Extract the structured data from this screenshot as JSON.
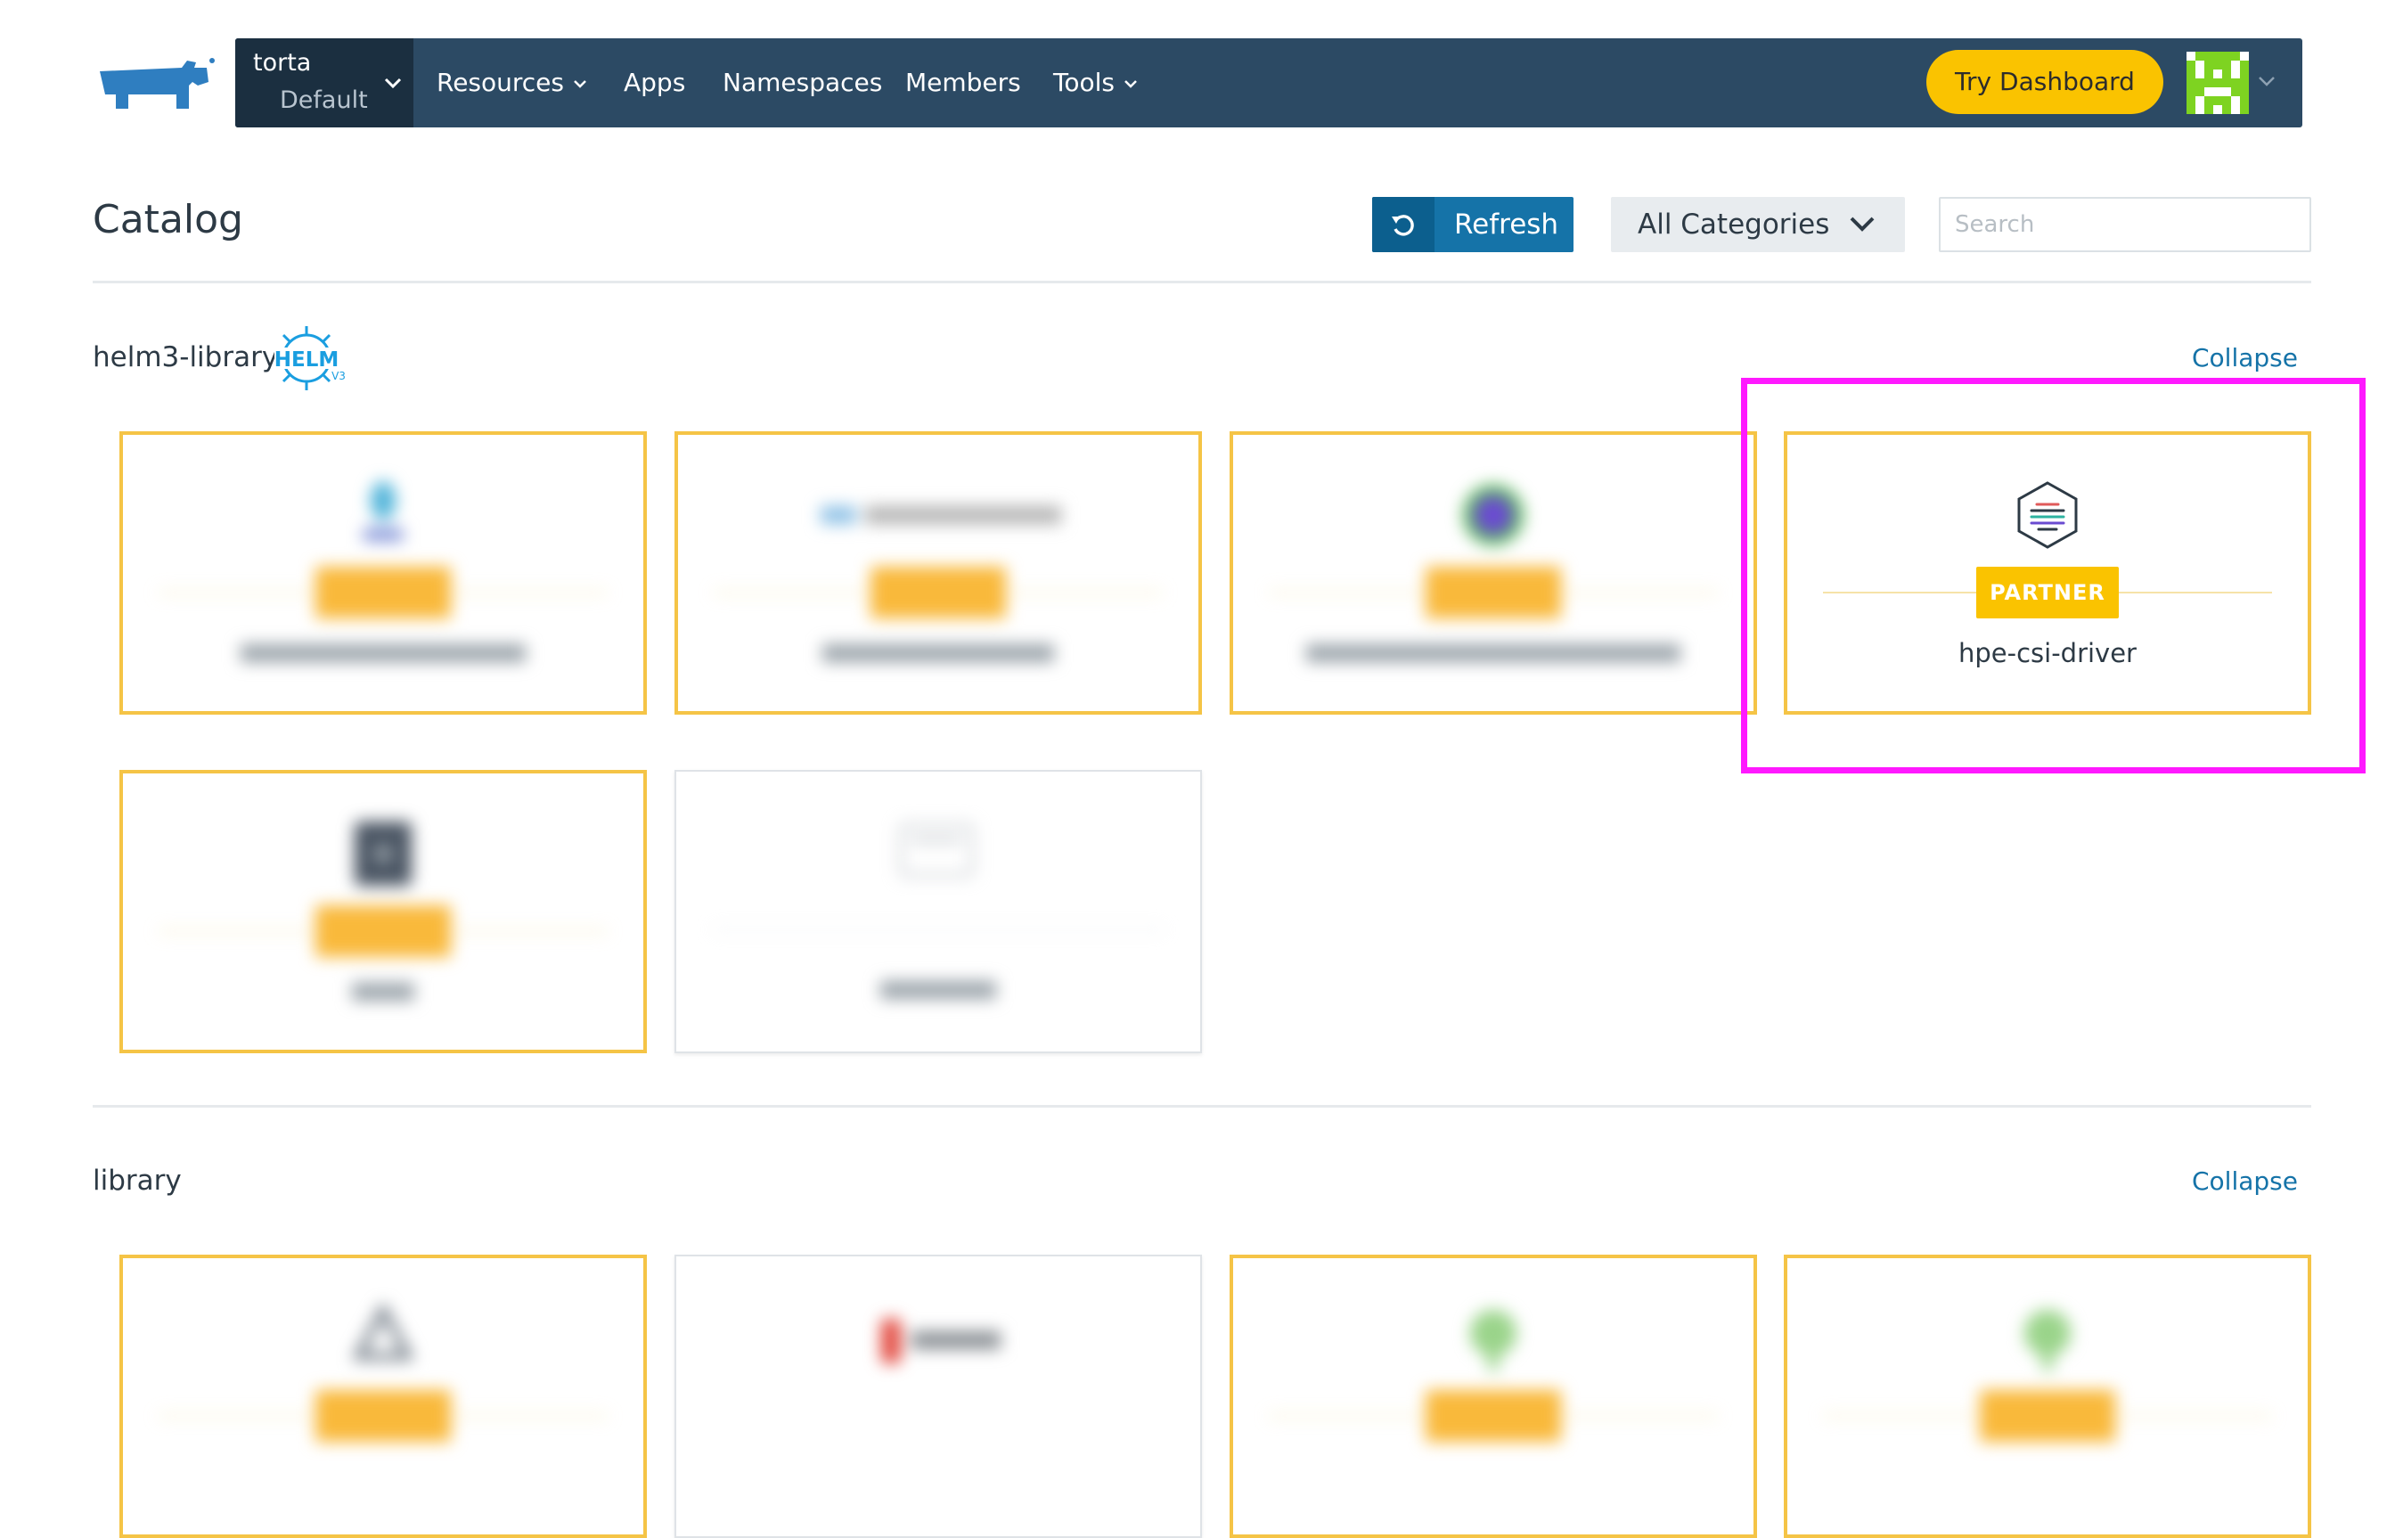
{
  "header": {
    "cluster": "torta",
    "project": "Default",
    "nav": [
      {
        "label": "Resources",
        "has_caret": true
      },
      {
        "label": "Apps",
        "has_caret": false
      },
      {
        "label": "Namespaces",
        "has_caret": false
      },
      {
        "label": "Members",
        "has_caret": false
      },
      {
        "label": "Tools",
        "has_caret": true
      }
    ],
    "try_dashboard": "Try Dashboard"
  },
  "page": {
    "title": "Catalog",
    "refresh_label": "Refresh",
    "category_select": "All Categories",
    "search_placeholder": "Search"
  },
  "sections": [
    {
      "title": "helm3-library",
      "badge": "HELM",
      "badge_version": "V3",
      "collapse_label": "Collapse",
      "cards": [
        {
          "name": "",
          "partner": true,
          "blurred": true
        },
        {
          "name": "",
          "partner": true,
          "blurred": true
        },
        {
          "name": "",
          "partner": true,
          "blurred": true
        },
        {
          "name": "hpe-csi-driver",
          "partner": true,
          "badge": "PARTNER",
          "blurred": false
        },
        {
          "name": "",
          "partner": true,
          "blurred": true
        },
        {
          "name": "",
          "partner": false,
          "blurred": true
        }
      ]
    },
    {
      "title": "library",
      "collapse_label": "Collapse",
      "cards": [
        {
          "name": "",
          "partner": true,
          "blurred": true
        },
        {
          "name": "",
          "partner": false,
          "blurred": true
        },
        {
          "name": "",
          "partner": true,
          "blurred": true
        },
        {
          "name": "",
          "partner": true,
          "blurred": true
        }
      ]
    }
  ],
  "colors": {
    "nav_bg": "#2c4a64",
    "accent_blue": "#1573a8",
    "partner_yellow": "#fac300",
    "highlight": "#ff19ff"
  }
}
